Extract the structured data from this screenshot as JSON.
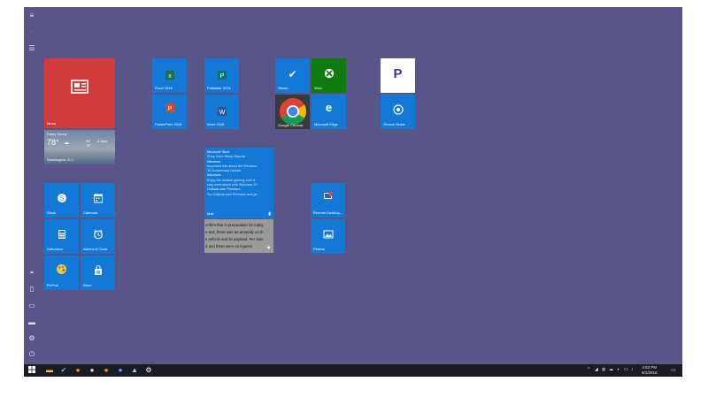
{
  "rail": {
    "icons": [
      "hamburger-icon",
      "highlight-icon",
      "list-icon",
      "user-icon",
      "document-icon",
      "photos-icon",
      "monitor-icon",
      "settings-icon",
      "power-icon"
    ]
  },
  "tiles": {
    "news": {
      "label": "News"
    },
    "weather": {
      "city": "Partly Sunny",
      "temp": "78°",
      "hi": "95°",
      "lo": "74°",
      "wind": "2 Mph",
      "location": "Washington, D.C."
    },
    "excel": {
      "label": "Excel 2016"
    },
    "publisher": {
      "label": "Publisher 2016"
    },
    "powerpoint": {
      "label": "PowerPoint 2016"
    },
    "word": {
      "label": "Word 2016"
    },
    "steam": {
      "label": "Steam"
    },
    "xbox": {
      "label": "Xbox"
    },
    "chrome": {
      "label": "Google Chrome"
    },
    "edge": {
      "label": "Microsoft Edge"
    },
    "pandora": {
      "label": ""
    },
    "groove": {
      "label": "Groove Music"
    },
    "skype": {
      "label": "Slack"
    },
    "calendar": {
      "label": "Calendar"
    },
    "calculator": {
      "label": "Calculator"
    },
    "alarms": {
      "label": "Alarms & Clock"
    },
    "paint": {
      "label": "PicPick"
    },
    "store": {
      "label": "Store"
    },
    "mail": {
      "label": "Mail",
      "lines": [
        "Microsoft Store",
        "Shop Save Relax Repeat",
        "Windows",
        "Important info about the Windows",
        "10 Anniversary Update",
        "Windows",
        "Enjoy the newest gaming ever &",
        "stay entertained with Windows 10",
        "Outlook.com Premium",
        "Try Outlook.com Premium and ge..."
      ]
    },
    "news_text": {
      "lines": [
        "onfirm that in preparation for today",
        "e test, there was an anomaly on th",
        "e vehicle and its payload. Per stan",
        "d and there were no injuries"
      ]
    },
    "remote": {
      "label": "Remote Desktop..."
    },
    "photos": {
      "label": "Photos"
    }
  },
  "taskbar": {
    "time": "4:53 PM",
    "date": "9/1/2016",
    "icons": [
      "start-icon",
      "file-explorer-icon",
      "mail-taskbar-icon",
      "firefox-icon",
      "steam-taskbar-icon",
      "chrome-taskbar-icon",
      "app-taskbar-icon",
      "skype-taskbar-icon",
      "settings-taskbar-icon"
    ]
  },
  "colors": {
    "desktop": "#5a5588",
    "tile": "#1479d6",
    "news": "#d23b3b",
    "xbox": "#107c10",
    "taskbar": "#1b1b24"
  }
}
